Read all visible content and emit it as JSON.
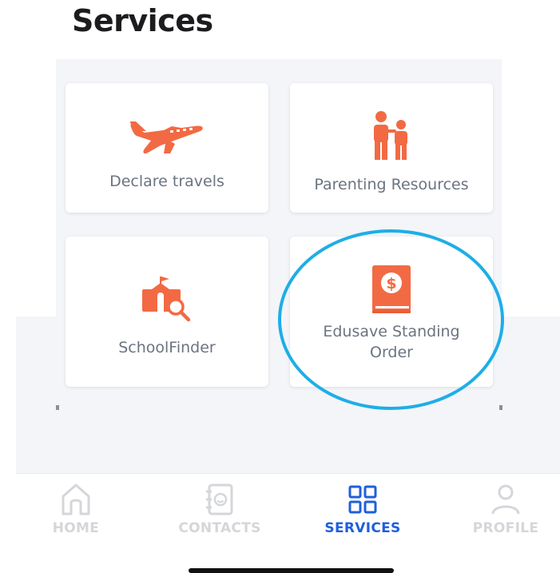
{
  "header": {
    "title": "Services"
  },
  "services": [
    {
      "label": "Declare travels",
      "icon": "airplane-icon"
    },
    {
      "label": "Parenting Resources",
      "icon": "parent-child-icon"
    },
    {
      "label": "SchoolFinder",
      "icon": "school-search-icon"
    },
    {
      "label": "Edusave Standing Order",
      "icon": "dollar-book-icon"
    }
  ],
  "tabs": [
    {
      "label": "HOME",
      "icon": "home-icon",
      "active": false
    },
    {
      "label": "CONTACTS",
      "icon": "contacts-icon",
      "active": false
    },
    {
      "label": "SERVICES",
      "icon": "grid-icon",
      "active": true
    },
    {
      "label": "PROFILE",
      "icon": "profile-icon",
      "active": false
    }
  ],
  "colors": {
    "accent_orange": "#f26a43",
    "active_tab": "#1f5fdb",
    "inactive_tab": "#d4d6da",
    "highlight_ring": "#1eaee6",
    "card_label": "#6b7480",
    "background": "#f3f5f9"
  }
}
